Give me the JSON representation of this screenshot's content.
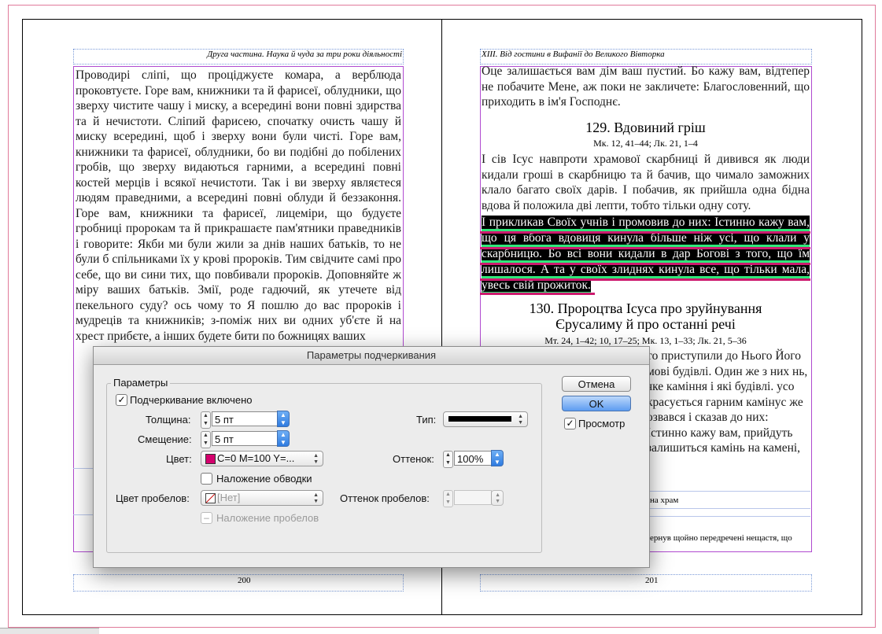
{
  "left_page": {
    "running_head": "Друга частина. Наука й чуда за три роки діяльності",
    "page_number": "200",
    "body_text": "Проводирі сліпі, що проціджуєте комара, а верблюда проковтуєте. Горе вам, книжники та й фарисеї, облудники, що зверху чистите чашу і миску, а всередині вони повні здирства та й нечистоти. Сліпий фарисею, спочатку очисть чашу й миску всередині, щоб і зверху вони були чисті. Горе вам, книжники та фарисеї, облудники, бо ви подібні до побілених гробів, що зверху видаються гарними, а всередині повні костей мерців і всякої нечистоти. Так і ви зверху являєтеся людям праведними, а всередині повні облуди й беззаконня. Горе вам, книжники та фарисеї, лицеміри, що будуєте гробниці пророкам та й прикрашаєте пам'ятники праведників і говорите: Якби ми були жили за днів наших батьків, то не були б спільниками їх у крові пророків. Тим свідчите самі про себе, що ви сини тих, що повбивали пророків. Доповняйте ж міру ваших батьків. Змії, роде гадючий, як утечете від пекельного суду? ось чому то Я пошлю до вас пророків і мудреців та книжників; з-поміж них ви одних уб'єте й на хрест прибєте, а інших будете бити по божницях ваших"
  },
  "right_page": {
    "running_head": "XIII. Від гостини в Вифанії до Великого Вівторка",
    "page_number": "201",
    "para1": "Оце залишається вам дім ваш пустий. Бо кажу вам, відтепер не побачите Мене, аж поки не закличете: Благословенний, що приходить в ім'я Господнє.",
    "heading1": "129. Вдовиний гріш",
    "ref1": "Мк. 12, 41–44; Лк. 21, 1–4",
    "para2": "І сів Ісус навпроти храмової скарбниці й дивився як люди кидали гроші в скарбницю та й бачив, що чимало заможних клало багато своїх дарів. І побачив, як прийшла одна бідна вдова й положила дві лепти, тобто тільки одну соту.",
    "para3_highlight": "І прикликав Своїх учнів і промовив до них: Істинно кажу вам, що ця вбога вдовиця кинула більше ніж усі, що клали у скарбницю. Бо всі вони кидали в дар Богові з того, що їм лишалося. А та у своїх злиднях кинула все, що тільки мала, увесь свій прожиток.",
    "heading2_line1": "130. Пророцтва Ісуса про зруйнування",
    "heading2_line2": "Єрусалиму й про останні речі",
    "ref2": "Мт. 24, 1–42; 10, 17–25; Мк. 13, 1–33; Лк. 21, 5–36",
    "para4_visible": "то приступили до Нього Його мові будівлі. Один же з них нь, яке каміння і які будівлі. усо красується гарним камінус же озвався і сказав до них: Істинно кажу вам, прийдуть залишиться камінь на камені,",
    "fragment_note": "на храм",
    "footnote_fragment": "ернув щойно передречені нещастя, що"
  },
  "dialog": {
    "title": "Параметры подчеркивания",
    "group_label": "Параметры",
    "underline_on_label": "Подчеркивание включено",
    "underline_on_checked": true,
    "weight_label": "Толщина:",
    "weight_value": "5 пт",
    "offset_label": "Смещение:",
    "offset_value": "5 пт",
    "type_label": "Тип:",
    "color_label": "Цвет:",
    "color_value": "C=0 M=100 Y=...",
    "color_swatch": "#d4006d",
    "tint_label": "Оттенок:",
    "tint_value": "100%",
    "overprint_stroke_label": "Наложение обводки",
    "overprint_stroke_checked": false,
    "gap_color_label": "Цвет пробелов:",
    "gap_color_value": "[Нет]",
    "gap_tint_label": "Оттенок пробелов:",
    "gap_tint_value": "",
    "overprint_gap_label": "Наложение пробелов",
    "cancel_label": "Отмена",
    "ok_label": "OK",
    "preview_label": "Просмотр",
    "preview_checked": true
  },
  "colors": {
    "underline_green": "#2ee87a",
    "underline_magenta": "#cc1a6e",
    "margin_guides": "#b04ad0",
    "accent_blue": "#5d9cf1"
  }
}
